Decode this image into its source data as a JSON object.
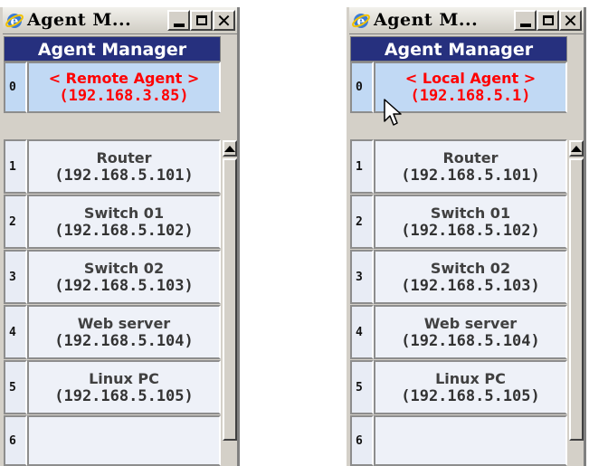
{
  "colors": {
    "header_bg": "#26307e",
    "row0_bg": "#c1d9f4",
    "accent_red": "#ff0000",
    "text_gray": "#404040"
  },
  "windows": [
    {
      "title": "Agent M...",
      "header": "Agent Manager",
      "row0": {
        "index": "0",
        "line1": "< Remote Agent >",
        "line2": "(192.168.3.85)"
      },
      "rows": [
        {
          "index": "1",
          "name": "Router",
          "ip": "(192.168.5.101)"
        },
        {
          "index": "2",
          "name": "Switch 01",
          "ip": "(192.168.5.102)"
        },
        {
          "index": "3",
          "name": "Switch 02",
          "ip": "(192.168.5.103)"
        },
        {
          "index": "4",
          "name": "Web server",
          "ip": "(192.168.5.104)"
        },
        {
          "index": "5",
          "name": "Linux PC",
          "ip": "(192.168.5.105)"
        },
        {
          "index": "6",
          "name": "",
          "ip": ""
        }
      ]
    },
    {
      "title": "Agent M...",
      "header": "Agent Manager",
      "row0": {
        "index": "0",
        "line1": "< Local Agent >",
        "line2": "(192.168.5.1)"
      },
      "rows": [
        {
          "index": "1",
          "name": "Router",
          "ip": "(192.168.5.101)"
        },
        {
          "index": "2",
          "name": "Switch 01",
          "ip": "(192.168.5.102)"
        },
        {
          "index": "3",
          "name": "Switch 02",
          "ip": "(192.168.5.103)"
        },
        {
          "index": "4",
          "name": "Web server",
          "ip": "(192.168.5.104)"
        },
        {
          "index": "5",
          "name": "Linux PC",
          "ip": "(192.168.5.105)"
        },
        {
          "index": "6",
          "name": "",
          "ip": ""
        }
      ]
    }
  ],
  "icons": {
    "app": "ie-app-icon",
    "minimize": "minimize-icon",
    "maximize": "maximize-icon",
    "close": "close-icon",
    "scroll_up": "scroll-up-arrow-icon",
    "cursor": "mouse-pointer-icon"
  }
}
